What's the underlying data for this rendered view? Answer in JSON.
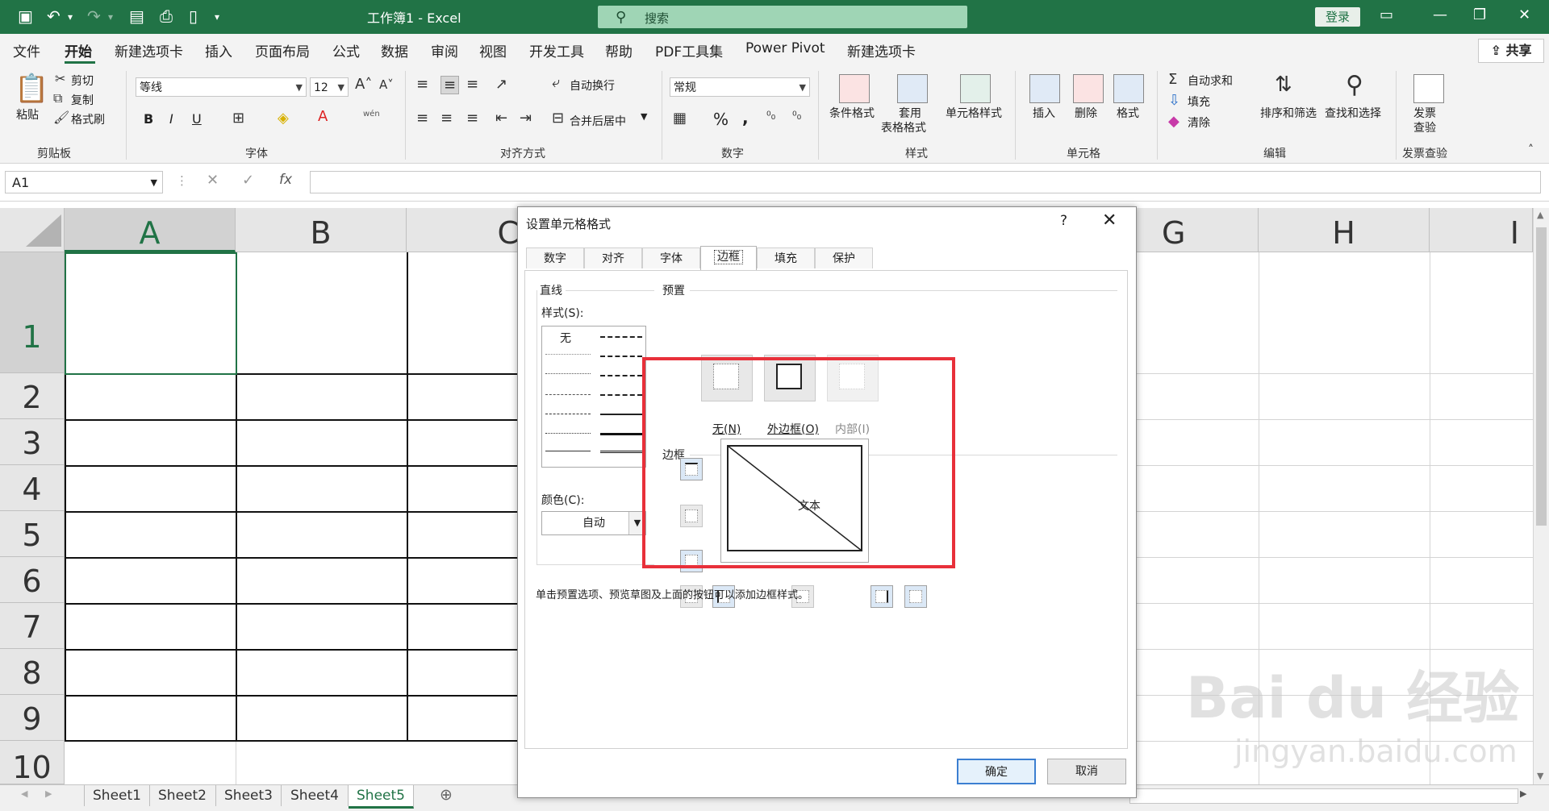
{
  "titlebar": {
    "doc_title": "工作簿1  -  Excel",
    "search_placeholder": "搜索",
    "login": "登录"
  },
  "menu": [
    "文件",
    "开始",
    "新建选项卡",
    "插入",
    "页面布局",
    "公式",
    "数据",
    "审阅",
    "视图",
    "开发工具",
    "帮助",
    "PDF工具集",
    "Power Pivot",
    "新建选项卡"
  ],
  "share": "共享",
  "ribbon": {
    "clipboard": {
      "label": "剪贴板",
      "paste": "粘贴",
      "cut": "剪切",
      "copy": "复制",
      "format_painter": "格式刷"
    },
    "font": {
      "label": "字体",
      "font_name": "等线",
      "font_size": "12",
      "bold": "B",
      "italic": "I",
      "underline": "U",
      "phonetic": "wén"
    },
    "align": {
      "label": "对齐方式",
      "wrap": "自动换行",
      "merge": "合并后居中"
    },
    "number": {
      "label": "数字",
      "format": "常规",
      "percent": "%",
      "comma": ","
    },
    "styles": {
      "label": "样式",
      "cond_l1": "条件格式",
      "table_l1": "套用",
      "table_l2": "表格格式",
      "cell_style": "单元格样式"
    },
    "cells": {
      "label": "单元格",
      "insert": "插入",
      "delete": "删除",
      "format": "格式"
    },
    "edit": {
      "label": "编辑",
      "autosum": "自动求和",
      "fill": "填充",
      "clear": "清除",
      "sort": "排序和筛选",
      "find": "查找和选择"
    },
    "invoice": {
      "label": "发票查验",
      "l1": "发票",
      "l2": "查验"
    }
  },
  "formula": {
    "namebox": "A1",
    "fx": "fx"
  },
  "grid": {
    "columns": [
      "A",
      "B",
      "C",
      "",
      "",
      "",
      "G",
      "H",
      "I"
    ],
    "rows": [
      "1",
      "2",
      "3",
      "4",
      "5",
      "6",
      "7",
      "8",
      "9",
      "10"
    ]
  },
  "sheets": [
    "Sheet1",
    "Sheet2",
    "Sheet3",
    "Sheet4",
    "Sheet5"
  ],
  "dialog": {
    "title": "设置单元格格式",
    "help": "?",
    "tabs": [
      "数字",
      "对齐",
      "字体",
      "边框",
      "填充",
      "保护"
    ],
    "line_group": "直线",
    "style_label": "样式(S):",
    "style_none": "无",
    "color_label": "颜色(C):",
    "color_value": "自动",
    "preset_group": "预置",
    "preset_none": "无(N)",
    "preset_outline": "外边框(O)",
    "preset_inside": "内部(I)",
    "border_group": "边框",
    "preview_text": "文本",
    "hint": "单击预置选项、预览草图及上面的按钮可以添加边框样式。",
    "ok": "确定",
    "cancel": "取消"
  },
  "watermark": {
    "line1": "Bai du 经验",
    "line2": "jingyan.baidu.com"
  },
  "colors": {
    "excel_green": "#217346",
    "highlight": "#e8303a"
  }
}
